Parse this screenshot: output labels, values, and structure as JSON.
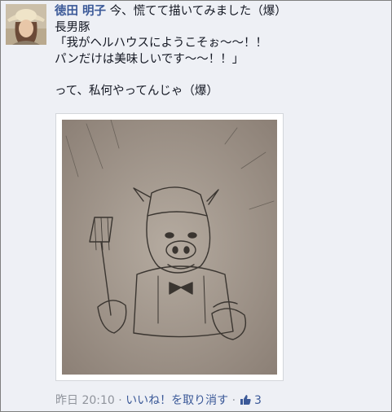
{
  "post": {
    "author": "徳田 明子",
    "lines": [
      "今、慌てて描いてみました（爆）",
      "長男豚",
      "「我がヘルハウスにようこそぉ〜〜！！",
      "パンだけは美味しいです〜〜！！」",
      "",
      "って、私何やってんじゃ（爆）"
    ]
  },
  "footer": {
    "timestamp": "昨日 20:10",
    "separator": "·",
    "unlike_label": "いいね！を取り消す",
    "like_count": "3"
  },
  "colors": {
    "link": "#3b5998",
    "meta": "#90949c",
    "background": "#eef0f5"
  },
  "icons": [
    "thumbs-up-icon"
  ]
}
